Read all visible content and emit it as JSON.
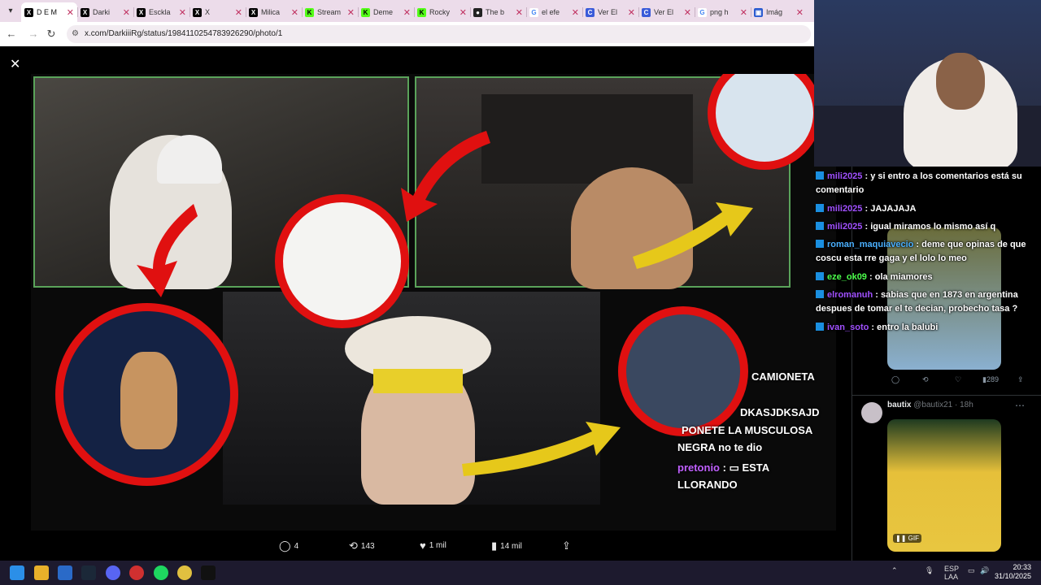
{
  "browser": {
    "tabs": [
      {
        "title": "D E M",
        "favicon": "x-icon",
        "active": true
      },
      {
        "title": "Darki",
        "favicon": "x-icon"
      },
      {
        "title": "Esckla",
        "favicon": "x-icon"
      },
      {
        "title": "X",
        "favicon": "x-icon"
      },
      {
        "title": "Milica",
        "favicon": "x-icon"
      },
      {
        "title": "Stream",
        "favicon": "kick-icon"
      },
      {
        "title": "Deme",
        "favicon": "kick-icon"
      },
      {
        "title": "Rocky",
        "favicon": "kick-icon"
      },
      {
        "title": "The b",
        "favicon": "github-icon"
      },
      {
        "title": "el efe",
        "favicon": "google-icon"
      },
      {
        "title": "Ver El",
        "favicon": "copilot-icon"
      },
      {
        "title": "Ver El",
        "favicon": "copilot-icon"
      },
      {
        "title": "png h",
        "favicon": "google-icon"
      },
      {
        "title": "Imág",
        "favicon": "images-icon"
      }
    ],
    "url": "x.com/DarkiiiRg/status/1984110254783926290/photo/1"
  },
  "viewer": {
    "overlay_chat": [
      {
        "text": "CAMIONETA"
      },
      {
        "text": "DKASJDKSAJD"
      },
      {
        "text": "PONETE LA MUSCULOSA"
      },
      {
        "text": "NEGRA no te dio"
      },
      {
        "name": "pretonio",
        "text": "ESTA"
      },
      {
        "text": "LLORANDO"
      }
    ],
    "actions": {
      "replies": "4",
      "reposts": "143",
      "likes": "1 mil",
      "views": "14 mil"
    }
  },
  "chat": [
    {
      "user": "mili2025",
      "text": "y si entro a los comentarios está su comentario",
      "color": "purple"
    },
    {
      "user": "mili2025",
      "text": "JAJAJAJA",
      "color": "purple"
    },
    {
      "user": "mili2025",
      "text": "igual miramos lo mismo así q",
      "color": "purple"
    },
    {
      "user": "roman_maquiavecio",
      "text": "deme que opinas de que coscu esta rre gaga y el lolo lo meo",
      "color": "blue"
    },
    {
      "user": "eze_ok09",
      "text": "ola miamores",
      "color": "green"
    },
    {
      "user": "elromanuh",
      "text": "sabias que en 1873 en argentina despues de tomar el te decian, probecho tasa ?",
      "color": "purple"
    },
    {
      "user": "ivan_soto",
      "text": "entro la balubi",
      "color": "purple"
    }
  ],
  "timeline": {
    "tweet1_views": "289",
    "tweet2": {
      "name": "bautix",
      "handle": "@bautix21 · 18h"
    },
    "gif_label": "GIF"
  },
  "taskbar": {
    "lang_top": "ESP",
    "lang_bottom": "LAA",
    "time": "20:33",
    "date": "31/10/2025"
  }
}
